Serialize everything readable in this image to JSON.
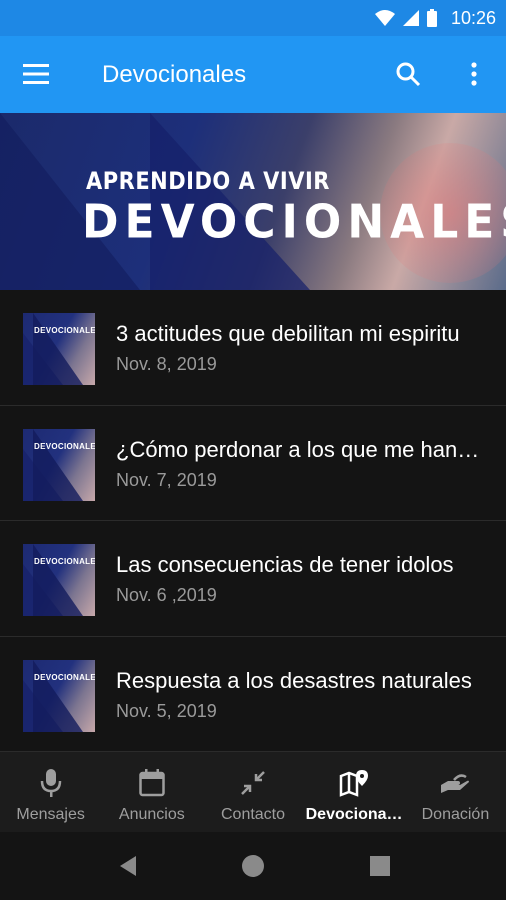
{
  "status_bar": {
    "time": "10:26"
  },
  "app_bar": {
    "title": "Devocionales"
  },
  "banner": {
    "subtitle": "APRENDIDO A VIVIR",
    "title": "DEVOCIONALES"
  },
  "thumb_label": "DEVOCIONALES",
  "items": [
    {
      "title": "3 actitudes que debilitan mi espiritu",
      "date": "Nov. 8, 2019"
    },
    {
      "title": "¿Cómo perdonar a los que me han herido?",
      "date": "Nov. 7, 2019"
    },
    {
      "title": "Las consecuencias de tener idolos",
      "date": "Nov. 6 ,2019"
    },
    {
      "title": "Respuesta a los desastres naturales",
      "date": "Nov. 5, 2019"
    }
  ],
  "bottom_nav": [
    {
      "label": "Mensajes",
      "icon": "mic-icon"
    },
    {
      "label": "Anuncios",
      "icon": "calendar-icon"
    },
    {
      "label": "Contacto",
      "icon": "compress-icon"
    },
    {
      "label": "Devocionales",
      "icon": "map-pin-icon",
      "active": true
    },
    {
      "label": "Donación",
      "icon": "hand-icon"
    }
  ],
  "colors": {
    "status_bar": "#1e88e5",
    "app_bar": "#2196f3",
    "background": "#141414",
    "nav_bg": "#1c1c1c"
  }
}
